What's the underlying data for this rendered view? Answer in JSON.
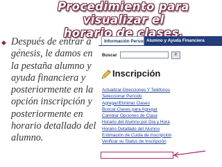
{
  "slide": {
    "title_line1": "Procedimiento para visualizar el",
    "title_line2": "horario de clases."
  },
  "bullet": {
    "icon": "diamond-bullet",
    "text": "Después de entrar a génesis, le damos en la pestaña alumno y ayuda financiera y posteriormente en la opción inscripción y posteriormente en horario detallado del alumno."
  },
  "screen": {
    "tabs": [
      {
        "label": "Información Personal",
        "active": false
      },
      {
        "label": "Alumno y Ayuda Financiera",
        "active": true
      }
    ],
    "search": {
      "label": "Buscar",
      "value": "",
      "button": "Ir"
    },
    "heading": "Inscripción",
    "menu": [
      "Actualizar Direcciones Y Teléfonos",
      "Seleccionar Período",
      "Agregar/Eliminar Clases",
      "Buscar Clases para Agregar",
      "Cambiar Opciones de Clase",
      "Horario del Alumno por Día y Hora",
      "Horario Detallado del Alumno",
      "Estimación de Cuota de Inscripción",
      "Verificar su Status de Inscripción"
    ],
    "highlighted_item": 6,
    "colors": {
      "tab_active": "#223d7a",
      "link": "#1f3f9a",
      "annotation": "#b0246c"
    }
  }
}
